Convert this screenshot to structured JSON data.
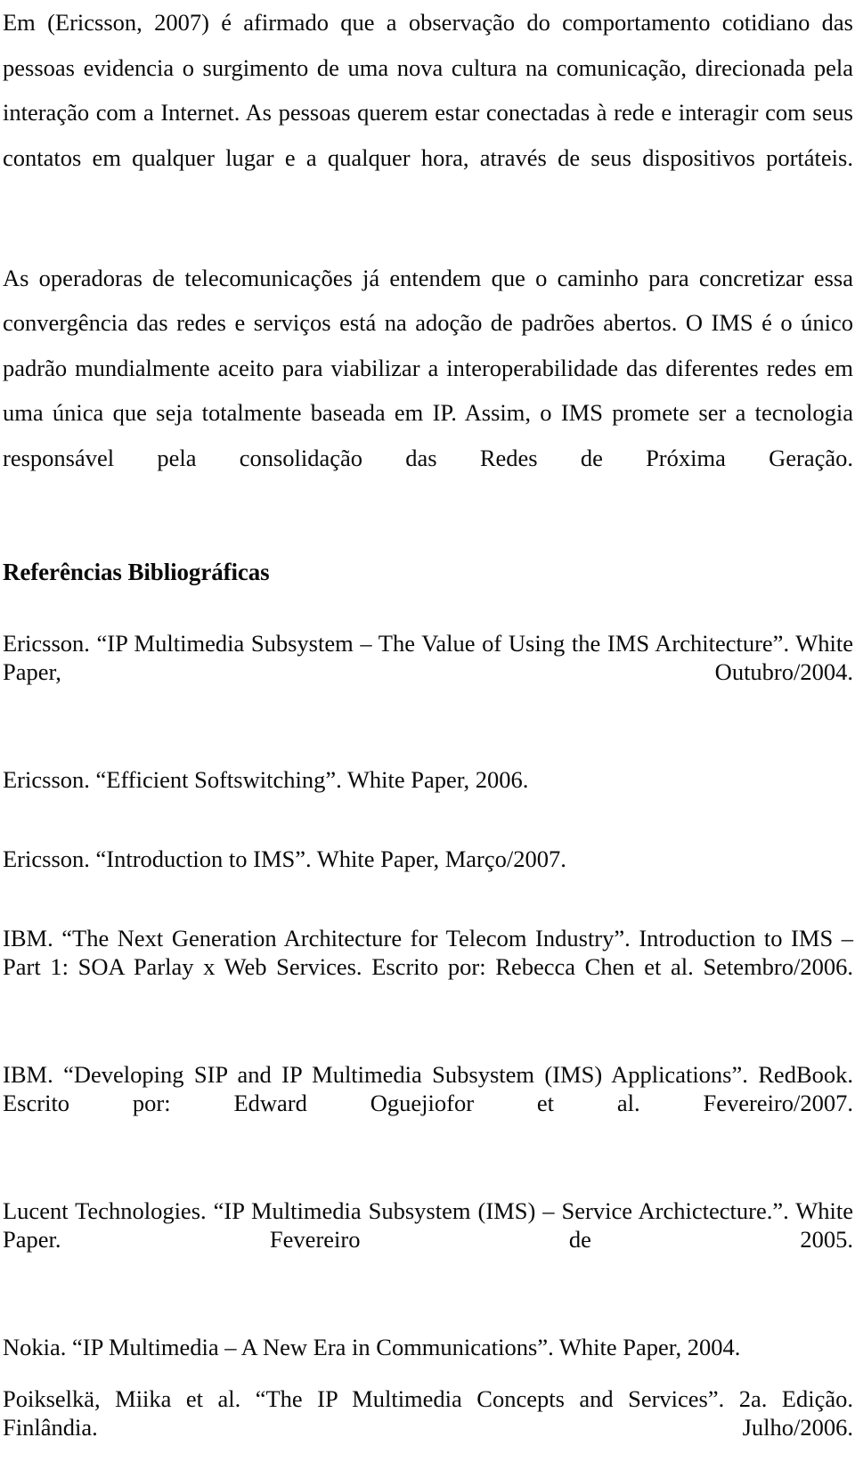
{
  "document": {
    "language": "pt-BR",
    "background_color": "#ffffff",
    "text_color": "#0a0a0a"
  },
  "body": {
    "paragraphs": [
      "Em (Ericsson, 2007) é afirmado que a observação do comportamento cotidiano das pessoas evidencia o surgimento de uma nova cultura na comunicação, direcionada pela interação com a Internet. As pessoas querem estar conectadas à rede e interagir com seus contatos em qualquer lugar e a qualquer hora, através de seus dispositivos portáteis.",
      "As operadoras de telecomunicações já entendem que o caminho para concretizar essa convergência das redes e serviços está na adoção de padrões abertos. O IMS é o único padrão mundialmente aceito para viabilizar a interoperabilidade das diferentes redes em uma única que seja totalmente baseada em IP. Assim, o IMS promete ser a tecnologia responsável pela consolidação das Redes de Próxima Geração."
    ]
  },
  "references_section": {
    "heading": "Referências Bibliográficas",
    "entries": [
      "Ericsson. “IP Multimedia Subsystem – The Value of Using the IMS Architecture”. White Paper, Outubro/2004.",
      "Ericsson. “Efficient Softswitching”. White Paper, 2006.",
      "Ericsson. “Introduction to IMS”. White Paper, Março/2007.",
      "IBM. “The Next Generation Architecture for Telecom Industry”. Introduction to IMS – Part 1: SOA Parlay x Web Services. Escrito por: Rebecca Chen et al. Setembro/2006.",
      "IBM. “Developing SIP and IP Multimedia Subsystem (IMS) Applications”. RedBook. Escrito por: Edward Oguejiofor et al. Fevereiro/2007.",
      "Lucent Technologies. “IP Multimedia Subsystem (IMS) – Service Archictecture.”. White Paper. Fevereiro de 2005.",
      "Nokia. “IP Multimedia – A New Era in Communications”. White Paper, 2004.",
      "Poikselkä, Miika et al. “The IP Multimedia Concepts and Services”. 2a. Edição. Finlândia. Julho/2006."
    ]
  }
}
